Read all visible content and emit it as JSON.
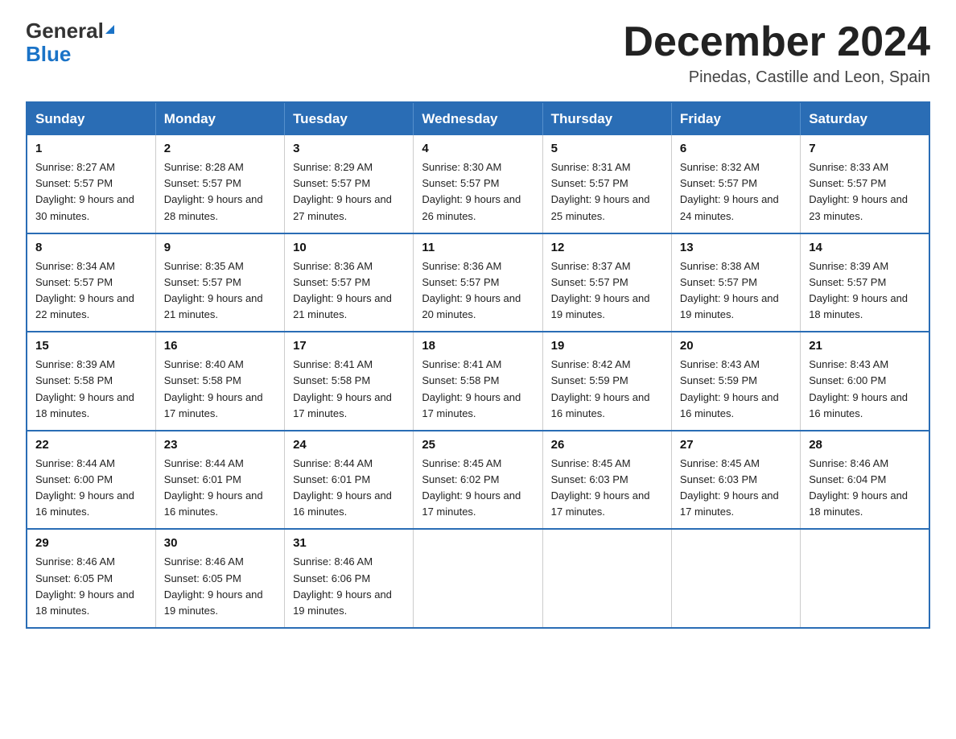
{
  "header": {
    "logo_general": "General",
    "logo_blue": "Blue",
    "month_title": "December 2024",
    "location": "Pinedas, Castille and Leon, Spain"
  },
  "weekdays": [
    "Sunday",
    "Monday",
    "Tuesday",
    "Wednesday",
    "Thursday",
    "Friday",
    "Saturday"
  ],
  "weeks": [
    [
      {
        "day": "1",
        "sunrise": "8:27 AM",
        "sunset": "5:57 PM",
        "daylight": "9 hours and 30 minutes."
      },
      {
        "day": "2",
        "sunrise": "8:28 AM",
        "sunset": "5:57 PM",
        "daylight": "9 hours and 28 minutes."
      },
      {
        "day": "3",
        "sunrise": "8:29 AM",
        "sunset": "5:57 PM",
        "daylight": "9 hours and 27 minutes."
      },
      {
        "day": "4",
        "sunrise": "8:30 AM",
        "sunset": "5:57 PM",
        "daylight": "9 hours and 26 minutes."
      },
      {
        "day": "5",
        "sunrise": "8:31 AM",
        "sunset": "5:57 PM",
        "daylight": "9 hours and 25 minutes."
      },
      {
        "day": "6",
        "sunrise": "8:32 AM",
        "sunset": "5:57 PM",
        "daylight": "9 hours and 24 minutes."
      },
      {
        "day": "7",
        "sunrise": "8:33 AM",
        "sunset": "5:57 PM",
        "daylight": "9 hours and 23 minutes."
      }
    ],
    [
      {
        "day": "8",
        "sunrise": "8:34 AM",
        "sunset": "5:57 PM",
        "daylight": "9 hours and 22 minutes."
      },
      {
        "day": "9",
        "sunrise": "8:35 AM",
        "sunset": "5:57 PM",
        "daylight": "9 hours and 21 minutes."
      },
      {
        "day": "10",
        "sunrise": "8:36 AM",
        "sunset": "5:57 PM",
        "daylight": "9 hours and 21 minutes."
      },
      {
        "day": "11",
        "sunrise": "8:36 AM",
        "sunset": "5:57 PM",
        "daylight": "9 hours and 20 minutes."
      },
      {
        "day": "12",
        "sunrise": "8:37 AM",
        "sunset": "5:57 PM",
        "daylight": "9 hours and 19 minutes."
      },
      {
        "day": "13",
        "sunrise": "8:38 AM",
        "sunset": "5:57 PM",
        "daylight": "9 hours and 19 minutes."
      },
      {
        "day": "14",
        "sunrise": "8:39 AM",
        "sunset": "5:57 PM",
        "daylight": "9 hours and 18 minutes."
      }
    ],
    [
      {
        "day": "15",
        "sunrise": "8:39 AM",
        "sunset": "5:58 PM",
        "daylight": "9 hours and 18 minutes."
      },
      {
        "day": "16",
        "sunrise": "8:40 AM",
        "sunset": "5:58 PM",
        "daylight": "9 hours and 17 minutes."
      },
      {
        "day": "17",
        "sunrise": "8:41 AM",
        "sunset": "5:58 PM",
        "daylight": "9 hours and 17 minutes."
      },
      {
        "day": "18",
        "sunrise": "8:41 AM",
        "sunset": "5:58 PM",
        "daylight": "9 hours and 17 minutes."
      },
      {
        "day": "19",
        "sunrise": "8:42 AM",
        "sunset": "5:59 PM",
        "daylight": "9 hours and 16 minutes."
      },
      {
        "day": "20",
        "sunrise": "8:43 AM",
        "sunset": "5:59 PM",
        "daylight": "9 hours and 16 minutes."
      },
      {
        "day": "21",
        "sunrise": "8:43 AM",
        "sunset": "6:00 PM",
        "daylight": "9 hours and 16 minutes."
      }
    ],
    [
      {
        "day": "22",
        "sunrise": "8:44 AM",
        "sunset": "6:00 PM",
        "daylight": "9 hours and 16 minutes."
      },
      {
        "day": "23",
        "sunrise": "8:44 AM",
        "sunset": "6:01 PM",
        "daylight": "9 hours and 16 minutes."
      },
      {
        "day": "24",
        "sunrise": "8:44 AM",
        "sunset": "6:01 PM",
        "daylight": "9 hours and 16 minutes."
      },
      {
        "day": "25",
        "sunrise": "8:45 AM",
        "sunset": "6:02 PM",
        "daylight": "9 hours and 17 minutes."
      },
      {
        "day": "26",
        "sunrise": "8:45 AM",
        "sunset": "6:03 PM",
        "daylight": "9 hours and 17 minutes."
      },
      {
        "day": "27",
        "sunrise": "8:45 AM",
        "sunset": "6:03 PM",
        "daylight": "9 hours and 17 minutes."
      },
      {
        "day": "28",
        "sunrise": "8:46 AM",
        "sunset": "6:04 PM",
        "daylight": "9 hours and 18 minutes."
      }
    ],
    [
      {
        "day": "29",
        "sunrise": "8:46 AM",
        "sunset": "6:05 PM",
        "daylight": "9 hours and 18 minutes."
      },
      {
        "day": "30",
        "sunrise": "8:46 AM",
        "sunset": "6:05 PM",
        "daylight": "9 hours and 19 minutes."
      },
      {
        "day": "31",
        "sunrise": "8:46 AM",
        "sunset": "6:06 PM",
        "daylight": "9 hours and 19 minutes."
      },
      null,
      null,
      null,
      null
    ]
  ]
}
